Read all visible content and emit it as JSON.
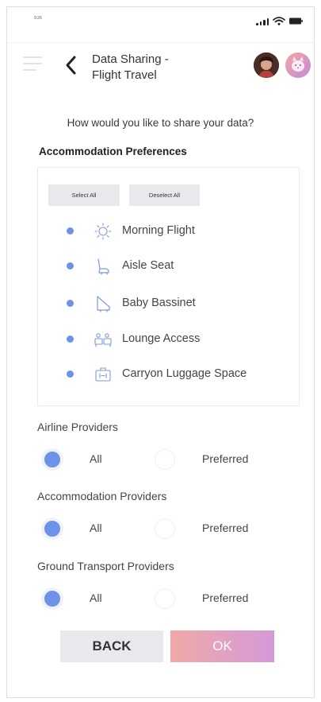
{
  "status_bar": {
    "time": "9:26",
    "icons": [
      "signal-icon",
      "wifi-icon",
      "battery-icon"
    ]
  },
  "header": {
    "title_line1": "Data Sharing -",
    "title_line2": "Flight Travel",
    "icons": [
      "menu-icon",
      "chevron-left-icon",
      "user-avatar",
      "pet-avatar"
    ]
  },
  "question": "How would you like to share your data?",
  "accommodation_preferences": {
    "heading": "Accommodation Preferences",
    "select_all_label": "Select All",
    "deselect_all_label": "Deselect All",
    "items": [
      {
        "label": "Morning Flight",
        "icon": "sun-icon",
        "selected": true
      },
      {
        "label": "Aisle Seat",
        "icon": "seat-icon",
        "selected": true
      },
      {
        "label": "Baby Bassinet",
        "icon": "bassinet-icon",
        "selected": true
      },
      {
        "label": "Lounge Access",
        "icon": "lounge-icon",
        "selected": true
      },
      {
        "label": "Carryon Luggage Space",
        "icon": "luggage-icon",
        "selected": true
      }
    ]
  },
  "provider_groups": [
    {
      "label": "Airline Providers",
      "option_all": "All",
      "option_preferred": "Preferred",
      "selected": "All"
    },
    {
      "label": "Accommodation Providers",
      "option_all": "All",
      "option_preferred": "Preferred",
      "selected": "All"
    },
    {
      "label": "Ground Transport Providers",
      "option_all": "All",
      "option_preferred": "Preferred",
      "selected": "All"
    }
  ],
  "buttons": {
    "back_label": "BACK",
    "ok_label": "OK"
  },
  "colors": {
    "accent_blue": "#6d93e8",
    "ok_gradient_start": "#f0a9a8",
    "ok_gradient_end": "#d49ad8",
    "neutral_button": "#e8e9ed"
  }
}
